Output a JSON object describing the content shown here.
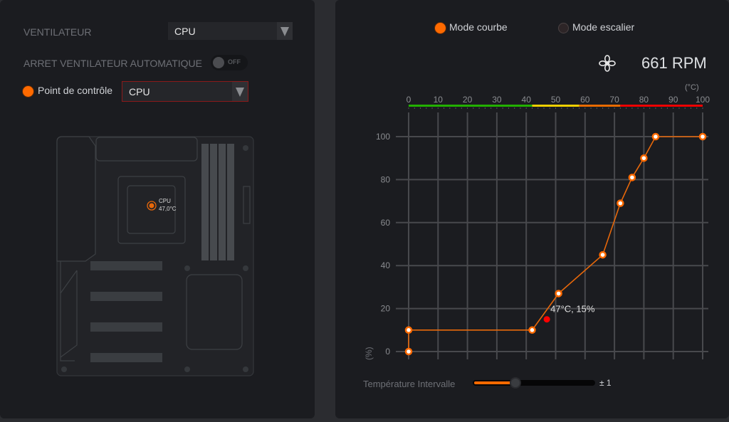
{
  "left": {
    "fan_label": "VENTILATEUR",
    "fan_select": "CPU",
    "auto_stop_label": "ARRET VENTILATEUR AUTOMATIQUE",
    "auto_stop_state": "OFF",
    "control_point_label": "Point de contrôle",
    "control_point_select": "CPU",
    "sensor": {
      "name": "CPU",
      "temp": "47,0°C"
    }
  },
  "right": {
    "mode_curve": "Mode courbe",
    "mode_stair": "Mode escalier",
    "selected_mode": "curve",
    "fan_icon": "fan-icon",
    "rpm": "661 RPM",
    "interval_label": "Température Intervalle",
    "interval_value": "± 1",
    "interval_fraction": 0.35
  },
  "chart_data": {
    "type": "line",
    "xlabel": "(°C)",
    "ylabel": "(%)",
    "xlim": [
      0,
      100
    ],
    "ylim": [
      0,
      100
    ],
    "x_ticks": [
      0,
      10,
      20,
      30,
      40,
      50,
      60,
      70,
      80,
      90,
      100
    ],
    "y_ticks": [
      0,
      20,
      40,
      60,
      80,
      100
    ],
    "grid": true,
    "temp_bands": [
      {
        "from": 0,
        "to": 42,
        "color": "#22b000"
      },
      {
        "from": 42,
        "to": 58,
        "color": "#f0d000"
      },
      {
        "from": 58,
        "to": 72,
        "color": "#e86a00"
      },
      {
        "from": 72,
        "to": 100,
        "color": "#ee0000"
      }
    ],
    "series": [
      {
        "name": "fan-curve",
        "color": "#e8680a",
        "points": [
          [
            0,
            0
          ],
          [
            0,
            10
          ],
          [
            42,
            10
          ],
          [
            51,
            27
          ],
          [
            66,
            45
          ],
          [
            72,
            69
          ],
          [
            76,
            81
          ],
          [
            80,
            90
          ],
          [
            84,
            100
          ],
          [
            100,
            100
          ]
        ]
      }
    ],
    "current": {
      "x": 47,
      "y": 15,
      "label": "47°C, 15%",
      "color": "#ff0000"
    }
  }
}
